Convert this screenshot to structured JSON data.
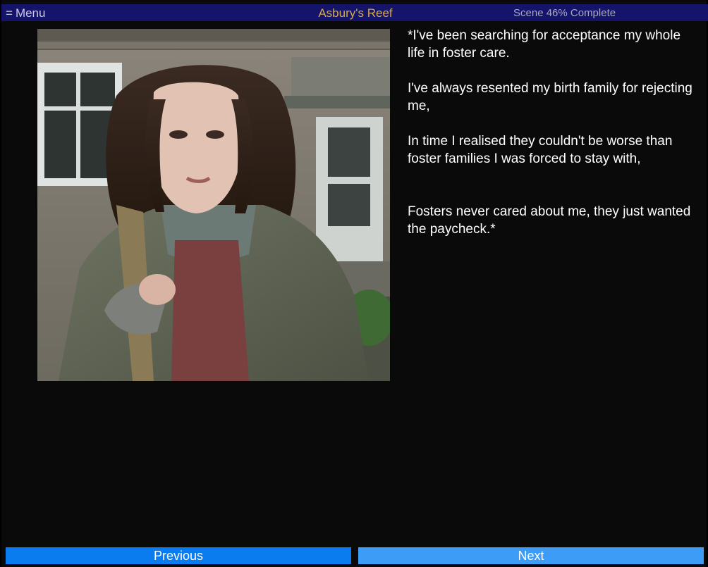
{
  "header": {
    "menu_icon": "menu-icon",
    "menu_label": "Menu",
    "title": "Asbury's Reef",
    "progress_text": "Scene 46% Complete",
    "background_color": "#14146a",
    "title_color": "#d4a94e"
  },
  "scene": {
    "image_icon": "character-portrait",
    "paragraphs": [
      "*I've been searching for acceptance my whole life in foster care.",
      "I've always resented my birth family for rejecting me,",
      "In time I realised they couldn't be worse than foster families I was forced to stay with,",
      "Fosters never cared about me, they just wanted the paycheck.*"
    ]
  },
  "navigation": {
    "previous_label": "Previous",
    "next_label": "Next",
    "previous_color": "#0a7cf0",
    "next_color": "#3d9cf5"
  }
}
